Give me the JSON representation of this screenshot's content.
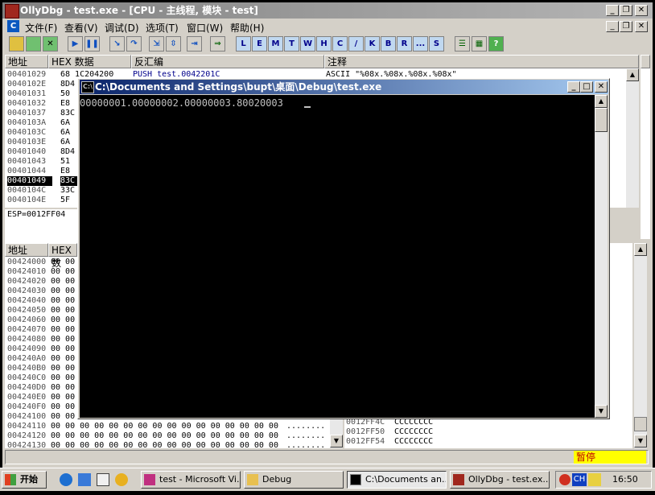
{
  "olly": {
    "title": "OllyDbg - test.exe - [CPU - 主线程, 模块 - test]",
    "app_letter": "C",
    "menu": [
      "文件(F)",
      "查看(V)",
      "调试(D)",
      "选项(T)",
      "窗口(W)",
      "帮助(H)"
    ],
    "letter_buttons": [
      "L",
      "E",
      "M",
      "T",
      "W",
      "H",
      "C",
      "/",
      "K",
      "B",
      "R",
      "...",
      "S"
    ],
    "disasm_headers": {
      "addr": "地址",
      "hex": "HEX 数据",
      "disasm": "反汇编",
      "comment": "注释"
    },
    "disasm_rows": [
      {
        "addr": "00401029",
        "hex": "68 1C204200",
        "ins": "PUSH test.0042201C",
        "cmt": "ASCII \"%08x.%08x.%08x.%08x\""
      },
      {
        "addr": "0040102E",
        "hex": "8D4",
        "ins": "",
        "cmt": ""
      },
      {
        "addr": "00401031",
        "hex": "50",
        "ins": "",
        "cmt": ""
      },
      {
        "addr": "00401032",
        "hex": "E8",
        "ins": "",
        "cmt": ""
      },
      {
        "addr": "00401037",
        "hex": "83C",
        "ins": "",
        "cmt": ""
      },
      {
        "addr": "0040103A",
        "hex": "6A",
        "ins": "",
        "cmt": ""
      },
      {
        "addr": "0040103C",
        "hex": "6A",
        "ins": "",
        "cmt": ""
      },
      {
        "addr": "0040103E",
        "hex": "6A",
        "ins": "",
        "cmt": ""
      },
      {
        "addr": "00401040",
        "hex": "8D4",
        "ins": "",
        "cmt": ""
      },
      {
        "addr": "00401043",
        "hex": "51",
        "ins": "",
        "cmt": ""
      },
      {
        "addr": "00401044",
        "hex": "E8",
        "ins": "",
        "cmt": ""
      },
      {
        "addr": "00401049",
        "hex": "83C",
        "ins": "",
        "cmt": ""
      },
      {
        "addr": "0040104C",
        "hex": "33C",
        "ins": "",
        "cmt": ""
      },
      {
        "addr": "0040104E",
        "hex": "5F",
        "ins": "",
        "cmt": ""
      }
    ],
    "esp_info": "ESP=0012FF04",
    "dump_headers": {
      "addr": "地址",
      "hex": "HEX 数"
    },
    "dump_rows": [
      "00424000",
      "00424010",
      "00424020",
      "00424030",
      "00424040",
      "00424050",
      "00424060",
      "00424070",
      "00424080",
      "00424090",
      "004240A0",
      "004240B0",
      "004240C0",
      "004240D0",
      "004240E0",
      "004240F0",
      "00424100",
      "00424110",
      "00424120",
      "00424130"
    ],
    "dump_bytes_tail": "00 00 00 00 00 00 00 00 00 00 00 00 00 00 00 00",
    "dump_ascii_tail": "........",
    "stack_rows": [
      {
        "addr": "0012FF4C",
        "val": "CCCCCCCC"
      },
      {
        "addr": "0012FF50",
        "val": "CCCCCCCC"
      },
      {
        "addr": "0012FF54",
        "val": "CCCCCCCC"
      }
    ],
    "status": "暂停",
    "status_color": "#ffff00"
  },
  "console": {
    "title": "C:\\Documents and Settings\\bupt\\桌面\\Debug\\test.exe",
    "output": "00000001.00000002.00000003.80020003"
  },
  "taskbar": {
    "start": "开始",
    "tasks": [
      "test - Microsoft Vi...",
      "Debug",
      "C:\\Documents an...",
      "OllyDbg - test.ex..."
    ],
    "ime": "CH",
    "clock": "16:50"
  }
}
